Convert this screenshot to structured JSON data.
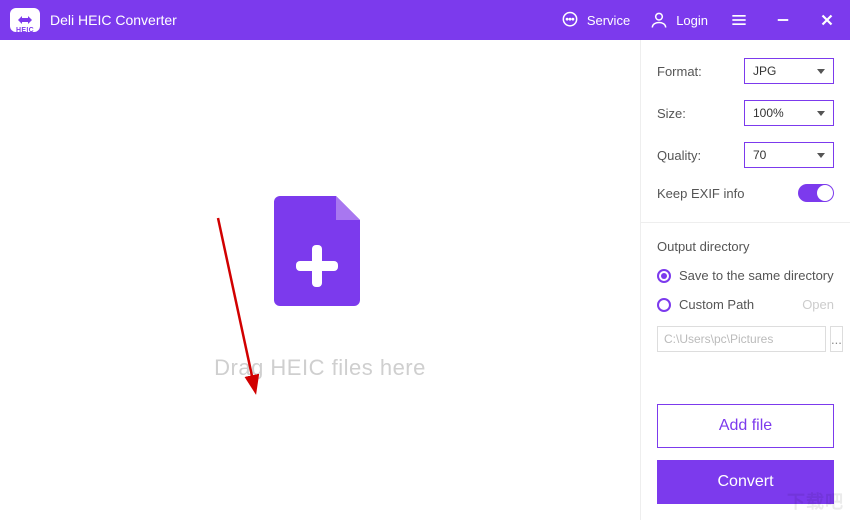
{
  "titlebar": {
    "logo_text": "HEIC",
    "app_title": "Deli HEIC Converter",
    "service_label": "Service",
    "login_label": "Login"
  },
  "drop": {
    "hint": "Drag HEIC files here"
  },
  "settings": {
    "format_label": "Format:",
    "format_value": "JPG",
    "size_label": "Size:",
    "size_value": "100%",
    "quality_label": "Quality:",
    "quality_value": "70",
    "exif_label": "Keep EXIF info",
    "exif_on": true
  },
  "output": {
    "section_label": "Output directory",
    "same_dir_label": "Save to the same directory",
    "custom_path_label": "Custom Path",
    "open_label": "Open",
    "path_value": "C:\\Users\\pc\\Pictures",
    "browse_label": "...",
    "selected": "same"
  },
  "buttons": {
    "add_file": "Add file",
    "convert": "Convert"
  },
  "watermark": "下载吧"
}
